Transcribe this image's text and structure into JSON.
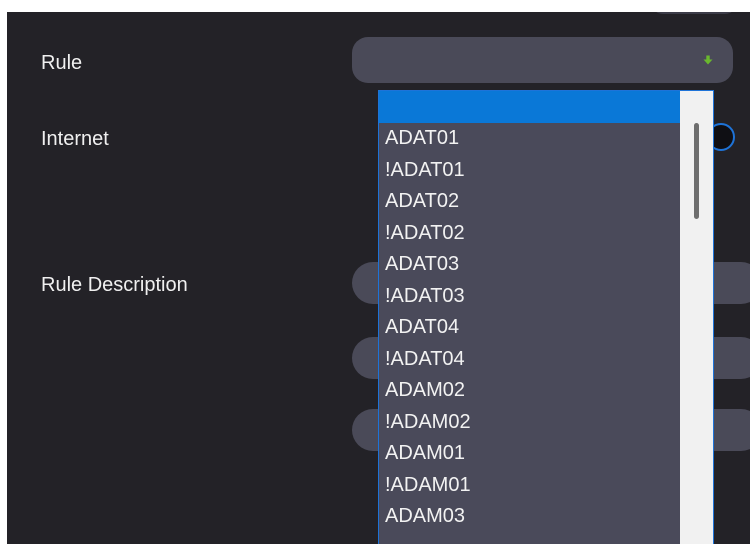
{
  "form": {
    "rule_label": "Rule",
    "internet_label": "Internet",
    "rule_description_label": "Rule Description",
    "rule_select_value": ""
  },
  "dropdown": {
    "selected_index": 0,
    "options": [
      "",
      "ADAT01",
      "!ADAT01",
      "ADAT02",
      "!ADAT02",
      "ADAT03",
      "!ADAT03",
      "ADAT04",
      "!ADAT04",
      "ADAM02",
      "!ADAM02",
      "ADAM01",
      "!ADAM01",
      "ADAM03"
    ]
  },
  "icons": {
    "select_arrow": "chevron-down-icon"
  },
  "colors": {
    "panel_bg": "#232227",
    "field_bg": "#4a4a58",
    "highlight": "#0a78d7",
    "arrow": "#6ab82e"
  }
}
